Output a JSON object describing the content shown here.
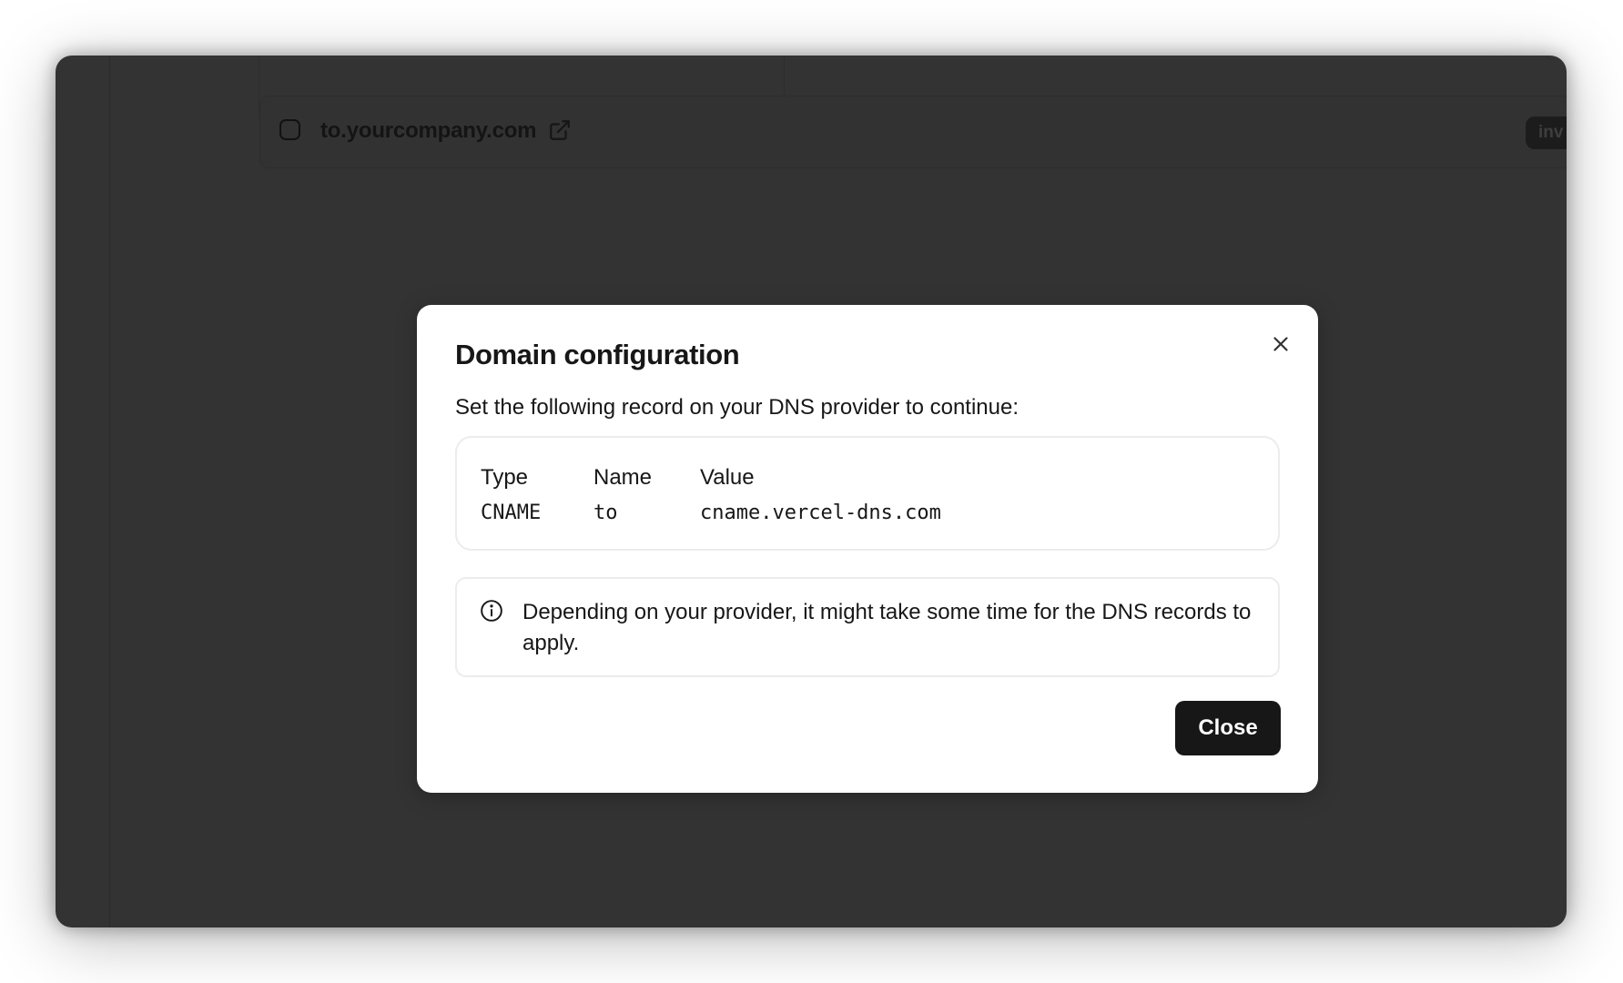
{
  "background": {
    "domain_row": {
      "domain": "to.yourcompany.com",
      "status_badge": "inv"
    }
  },
  "modal": {
    "title": "Domain configuration",
    "description": "Set the following record on your DNS provider to continue:",
    "record": {
      "headers": [
        "Type",
        "Name",
        "Value"
      ],
      "type": "CNAME",
      "name": "to",
      "value": "cname.vercel-dns.com"
    },
    "info_text": "Depending on your provider, it might take some time for the DNS records to apply.",
    "close_button_label": "Close"
  },
  "icons": {
    "close": "close-icon",
    "external_link": "external-link-icon",
    "info": "info-icon"
  },
  "colors": {
    "overlay": "#333333",
    "primary_button": "#171717"
  }
}
